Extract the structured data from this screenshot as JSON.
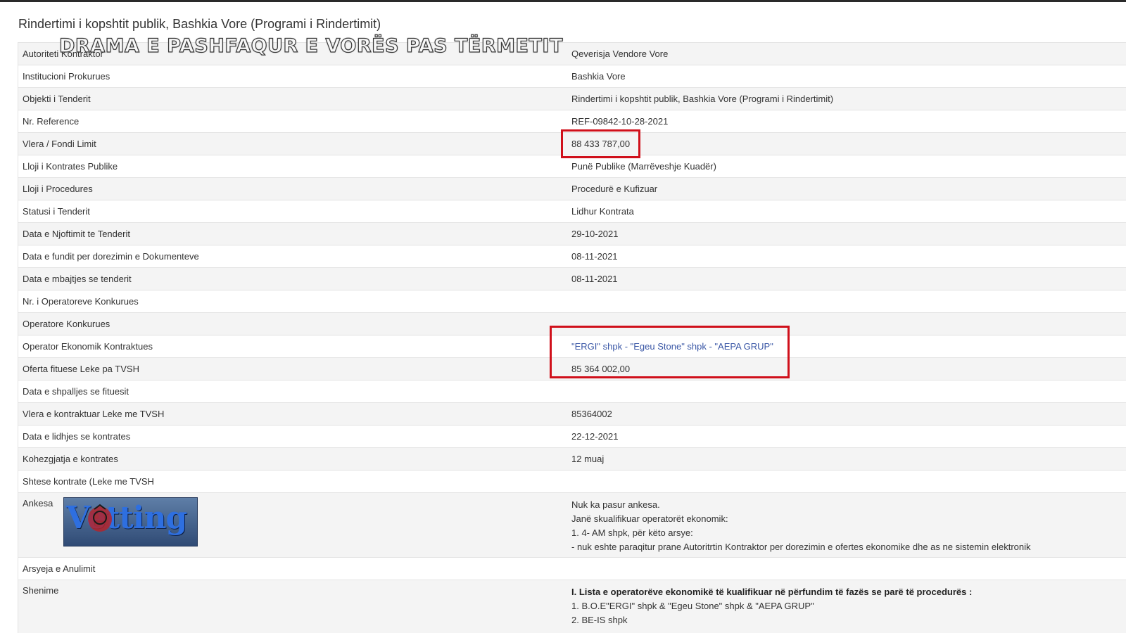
{
  "page": {
    "title": "Rindertimi i kopshtit publik, Bashkia Vore (Programi i Rindertimit)"
  },
  "overlay": {
    "headline": "DRAMA E PASHFAQUR E  VORËS PAS TËRMETIT",
    "logo_text": "Vetting"
  },
  "table": {
    "rows": [
      {
        "label": "Autoriteti Kontraktor",
        "value": "Qeverisja Vendore Vore"
      },
      {
        "label": "Institucioni Prokurues",
        "value": "Bashkia Vore"
      },
      {
        "label": "Objekti i Tenderit",
        "value": "Rindertimi i kopshtit publik, Bashkia Vore (Programi i Rindertimit)"
      },
      {
        "label": "Nr. Reference",
        "value": "REF-09842-10-28-2021"
      },
      {
        "label": "Vlera / Fondi Limit",
        "value": "88 433 787,00"
      },
      {
        "label": "Lloji i Kontrates Publike",
        "value": "Punë Publike (Marrëveshje Kuadër)"
      },
      {
        "label": "Lloji i Procedures",
        "value": "Procedurë e Kufizuar"
      },
      {
        "label": "Statusi i Tenderit",
        "value": "Lidhur Kontrata"
      },
      {
        "label": "Data e Njoftimit te Tenderit",
        "value": "29-10-2021"
      },
      {
        "label": "Data e fundit per dorezimin e Dokumenteve",
        "value": "08-11-2021"
      },
      {
        "label": "Data e mbajtjes se tenderit",
        "value": "08-11-2021"
      },
      {
        "label": "Nr. i Operatoreve Konkurues",
        "value": ""
      },
      {
        "label": "Operatore Konkurues",
        "value": ""
      },
      {
        "label": "Operator Ekonomik Kontraktues",
        "value": "\"ERGI\" shpk - \"Egeu Stone\" shpk - \"AEPA GRUP\""
      },
      {
        "label": "Oferta fituese Leke pa TVSH",
        "value": "85 364 002,00"
      },
      {
        "label": "Data e shpalljes se fituesit",
        "value": ""
      },
      {
        "label": "Vlera e kontraktuar Leke me TVSH",
        "value": "85364002"
      },
      {
        "label": "Data e lidhjes se kontrates",
        "value": "22-12-2021"
      },
      {
        "label": "Kohezgjatja e kontrates",
        "value": "12 muaj"
      },
      {
        "label": "Shtese kontrate (Leke me TVSH",
        "value": ""
      },
      {
        "label": "Ankesa",
        "lines": [
          "Nuk ka pasur ankesa.",
          "Janë skualifikuar operatorët ekonomik:",
          "1. 4- AM shpk, për këto arsye:",
          "- nuk eshte paraqitur prane Autoritrtin Kontraktor per dorezimin e ofertes ekonomike dhe as ne sistemin elektronik"
        ]
      },
      {
        "label": "Arsyeja e Anulimit",
        "value": ""
      },
      {
        "label": "Shenime",
        "lines": [
          "I. Lista e operatorëve ekonomikë të kualifikuar në përfundim të fazës se parë të procedurës :",
          "1. B.O.E\"ERGI\" shpk & \"Egeu Stone\" shpk & \"AEPA GRUP\"",
          "2. BE-IS shpk"
        ]
      }
    ]
  },
  "colors": {
    "highlight_box": "#d0101b",
    "link": "#3a57a6"
  }
}
